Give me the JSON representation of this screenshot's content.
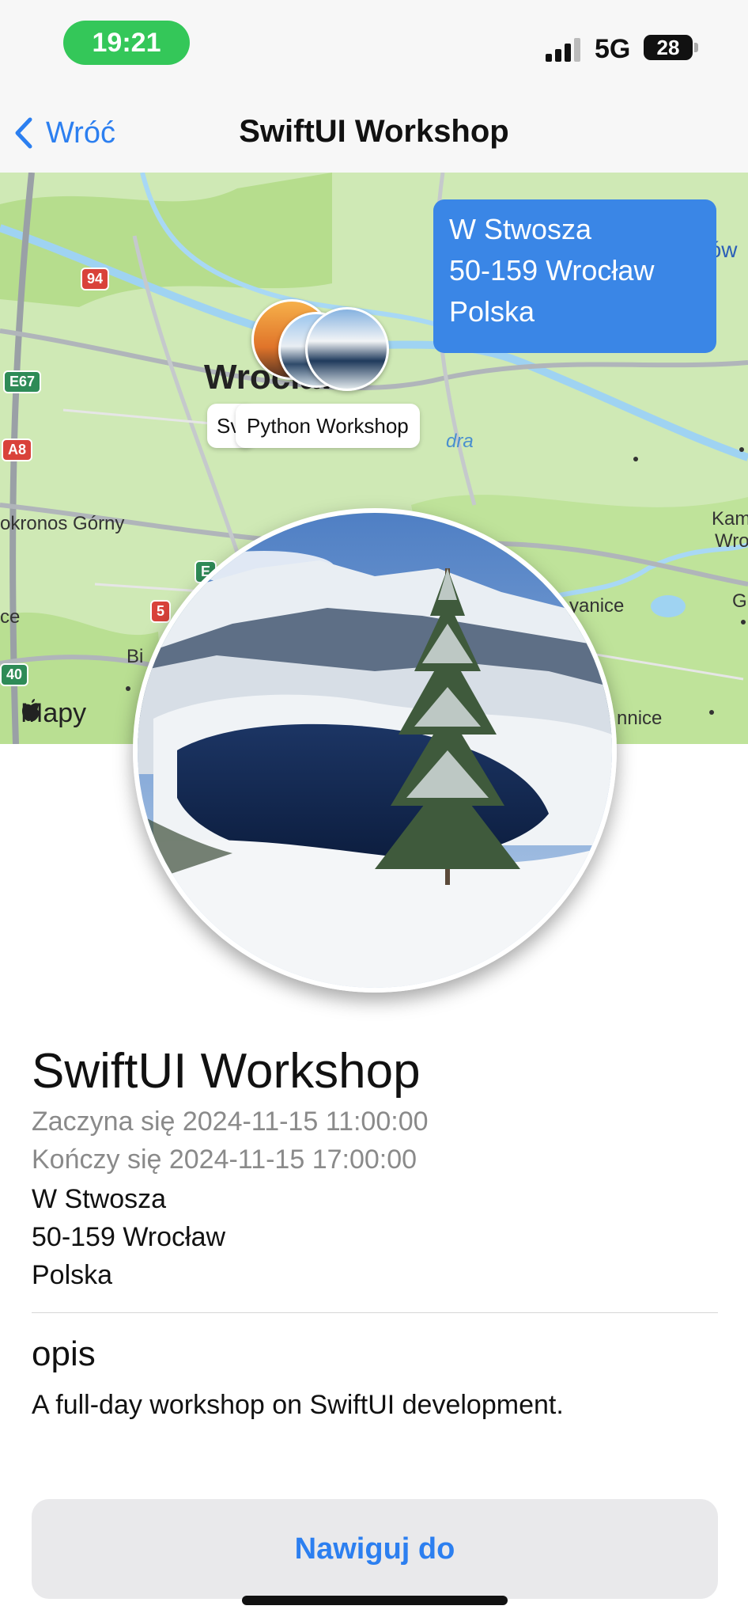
{
  "status_bar": {
    "time": "19:21",
    "network": "5G",
    "battery": "28",
    "pill_color": "#34c759"
  },
  "nav": {
    "back_label": "Wróć",
    "title": "SwiftUI Workshop",
    "accent_color": "#2c7ff0"
  },
  "map": {
    "address_card_lines": [
      "W Stwosza",
      "50-159 Wrocław",
      "Polska"
    ],
    "callout_partial": "Sv",
    "callout_label": "Python Workshop",
    "city_label": "Wrocław",
    "place_labels": [
      "Kiełczów",
      "okronos Górny",
      "Kam",
      "Wro",
      "G",
      "ce",
      "Bi",
      "yanice",
      "nnice",
      "dra"
    ],
    "road_shields": [
      "94",
      "E67",
      "A8",
      "E",
      "5",
      "40"
    ],
    "attribution": "Mapy",
    "card_color": "#3a86e6"
  },
  "event": {
    "title": "SwiftUI Workshop",
    "starts": "Zaczyna się 2024-11-15 11:00:00",
    "ends": "Kończy się 2024-11-15 17:00:00",
    "address_line1": "W Stwosza",
    "address_line2": "50-159 Wrocław",
    "address_line3": "Polska",
    "description_heading": "opis",
    "description": "A full-day workshop on SwiftUI development."
  },
  "actions": {
    "navigate_label": "Nawiguj do"
  }
}
